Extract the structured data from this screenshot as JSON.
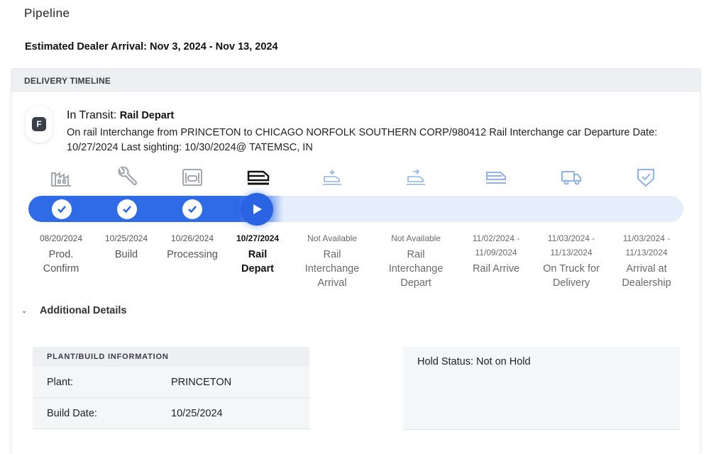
{
  "page": {
    "title": "Pipeline",
    "eta_label": "Estimated Dealer Arrival:",
    "eta_value": "Nov 3, 2024 - Nov 13, 2024"
  },
  "timeline": {
    "header": "DELIVERY TIMELINE",
    "carrier_initial": "F",
    "status_label": "In Transit:",
    "status_value": "Rail Depart",
    "status_description": "On rail Interchange from PRINCETON to CHICAGO NORFOLK SOUTHERN CORP/980412 Rail Interchange car Departure Date: 10/27/2024 Last sighting: 10/30/2024@ TATEMSC, IN",
    "progress_fraction": 0.39,
    "steps": [
      {
        "date": "08/20/2024",
        "name": "Prod. Confirm",
        "state": "complete",
        "icon": "factory-icon"
      },
      {
        "date": "10/25/2024",
        "name": "Build",
        "state": "complete",
        "icon": "wrench-icon"
      },
      {
        "date": "10/26/2024",
        "name": "Processing",
        "state": "complete",
        "icon": "processing-icon"
      },
      {
        "date": "10/27/2024",
        "name": "Rail Depart",
        "state": "current",
        "icon": "rail-car-icon"
      },
      {
        "date": "Not Available",
        "name": "Rail Interchange Arrival",
        "state": "future",
        "icon": "rail-interchange-arrival-icon"
      },
      {
        "date": "Not Available",
        "name": "Rail Interchange Depart",
        "state": "future",
        "icon": "rail-interchange-depart-icon"
      },
      {
        "date": "11/02/2024 - 11/09/2024",
        "name": "Rail Arrive",
        "state": "future",
        "icon": "rail-arrive-icon"
      },
      {
        "date": "11/03/2024 - 11/13/2024",
        "name": "On Truck for Delivery",
        "state": "future",
        "icon": "truck-icon"
      },
      {
        "date": "11/03/2024 - 11/13/2024",
        "name": "Arrival at Dealership",
        "state": "future",
        "icon": "shield-check-icon"
      }
    ]
  },
  "details": {
    "toggle_label": "Additional Details",
    "plant_header": "PLANT/BUILD INFORMATION",
    "rows": [
      {
        "key": "Plant:",
        "value": "PRINCETON"
      },
      {
        "key": "Build Date:",
        "value": "10/25/2024"
      }
    ],
    "hold_status": "Hold Status: Not on Hold"
  },
  "colors": {
    "accent": "#2f6be6",
    "track": "#e6eefb",
    "complete_icon": "#9aa0a8",
    "future_icon": "#8fb2e8"
  }
}
